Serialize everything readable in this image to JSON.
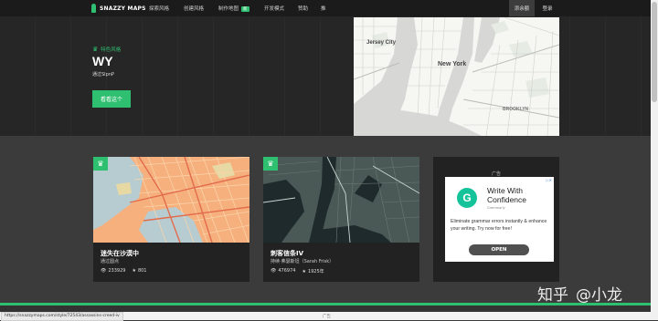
{
  "nav": {
    "brand": "SNAZZY MAPS",
    "items": [
      {
        "label": "探索风格"
      },
      {
        "label": "创建风格"
      },
      {
        "label": "制作地图",
        "badge": "新"
      },
      {
        "label": "开发模式"
      },
      {
        "label": "赞助"
      },
      {
        "label": "推"
      }
    ],
    "right": [
      {
        "label": "添余额"
      },
      {
        "label": "登录"
      }
    ]
  },
  "hero": {
    "feature_label": "特色风格",
    "title": "WY",
    "author": "通过SlpnP",
    "button": "看看这个",
    "map_labels": {
      "jersey_city": "Jersey City",
      "new_york": "New York",
      "brooklyn": "BROOKLYN"
    }
  },
  "cards": [
    {
      "title": "迷失在沙漠中",
      "author": "通过圆点",
      "views": "233929",
      "favorites": "801"
    },
    {
      "title": "刺客信条IV",
      "author": "持续·弗瑟斯坦（Sarah Frisk）",
      "views": "476974",
      "favorites": "1925年"
    }
  ],
  "ad": {
    "label": "广告",
    "headline": "Write With Confidence",
    "brand": "Grammarly",
    "body": "Eliminate grammar errors instantly & enhance your writing. Try now for free!",
    "cta": "OPEN",
    "logo_letter": "G"
  },
  "status": {
    "url": "https://snazzymaps.com/style/72543/assassins-creed-iv",
    "ad_label": "广告"
  },
  "watermark": {
    "site": "知乎",
    "user": "@小龙"
  },
  "colors": {
    "accent": "#2fbf71",
    "nav_bg": "#1b1b1b",
    "hero_bg": "#262626",
    "section_bg": "#3b3b3b",
    "card_bg": "#222222"
  }
}
